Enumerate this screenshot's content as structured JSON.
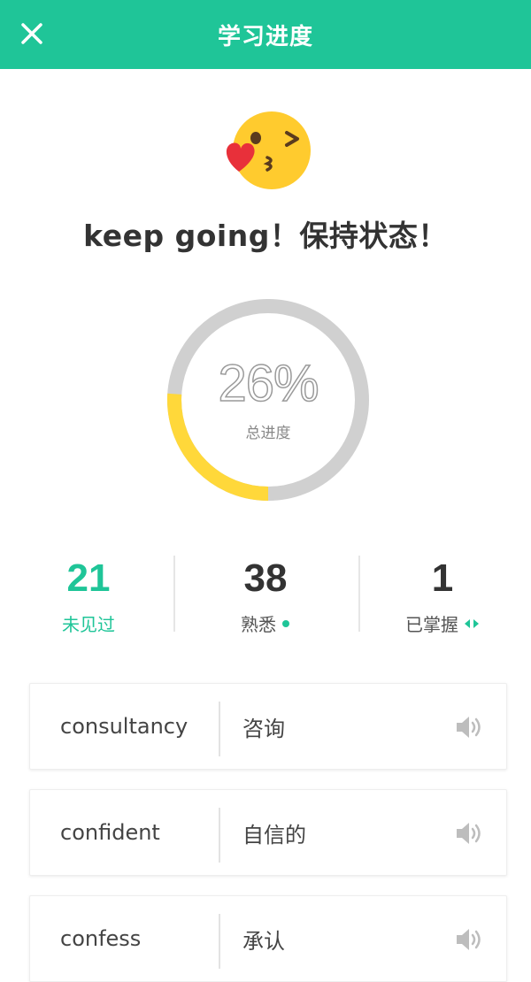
{
  "header": {
    "title": "学习进度",
    "close_icon": "close-icon",
    "background": "#1fc598"
  },
  "emoji_icon": "blowing-kiss-emoji-icon",
  "headline": "keep going！保持状态！",
  "progress": {
    "percent_text": "26%",
    "value": 0.26,
    "label": "总进度",
    "track_color": "#d0d0d0",
    "fill_color": "#ffd83a"
  },
  "stats": [
    {
      "value": "21",
      "label": "未见过",
      "color": "#1fc598"
    },
    {
      "value": "38",
      "label": "熟悉",
      "color": "#333333",
      "marker_icon": "dot-icon"
    },
    {
      "value": "1",
      "label": "已掌握",
      "color": "#333333",
      "marker_icon": "double-arrow-icon"
    }
  ],
  "words": [
    {
      "en": "consultancy",
      "cn": "咨询",
      "icon": "speaker-icon"
    },
    {
      "en": "confident",
      "cn": "自信的",
      "icon": "speaker-icon"
    },
    {
      "en": "confess",
      "cn": "承认",
      "icon": "speaker-icon"
    }
  ]
}
